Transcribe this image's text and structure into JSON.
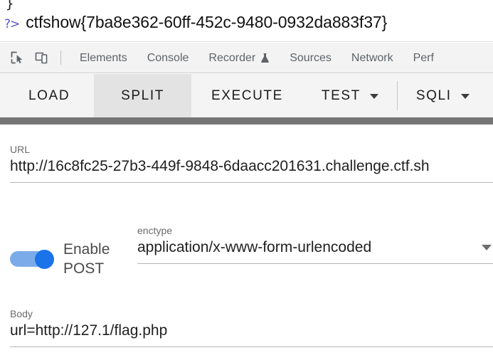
{
  "console": {
    "previous_line": "}",
    "prompt": "?>",
    "output": "ctfshow{7ba8e362-60ff-452c-9480-0932da883f37}"
  },
  "devtools": {
    "icons": [
      {
        "name": "inspect-element-icon"
      },
      {
        "name": "device-toolbar-icon"
      }
    ],
    "tabs": [
      {
        "label": "Elements",
        "active": false
      },
      {
        "label": "Console",
        "active": false
      },
      {
        "label": "Recorder",
        "active": false,
        "experiment": true
      },
      {
        "label": "Sources",
        "active": false
      },
      {
        "label": "Network",
        "active": false
      },
      {
        "label": "Perf",
        "active": false
      }
    ]
  },
  "action_bar": {
    "tabs": [
      {
        "label": "LOAD",
        "active": false,
        "has_caret": false
      },
      {
        "label": "SPLIT",
        "active": true,
        "has_caret": false
      },
      {
        "label": "EXECUTE",
        "active": false,
        "has_caret": false
      },
      {
        "label": "TEST",
        "active": false,
        "has_caret": true
      },
      {
        "label": "SQLI",
        "active": false,
        "has_caret": true
      }
    ]
  },
  "form": {
    "url": {
      "label": "URL",
      "value": "http://16c8fc25-27b3-449f-9848-6daacc201631.challenge.ctf.sh"
    },
    "post_toggle": {
      "label": "Enable POST",
      "enabled": true
    },
    "enctype": {
      "label": "enctype",
      "value": "application/x-www-form-urlencoded"
    },
    "body": {
      "label": "Body",
      "value": "url=http://127.1/flag.php"
    }
  },
  "colors": {
    "accent_blue": "#1a73e8",
    "toggle_track": "#7bace9",
    "divider_gray": "#757575",
    "active_tab_bg": "#e3e3e3",
    "prompt_purple": "#5555c8"
  }
}
